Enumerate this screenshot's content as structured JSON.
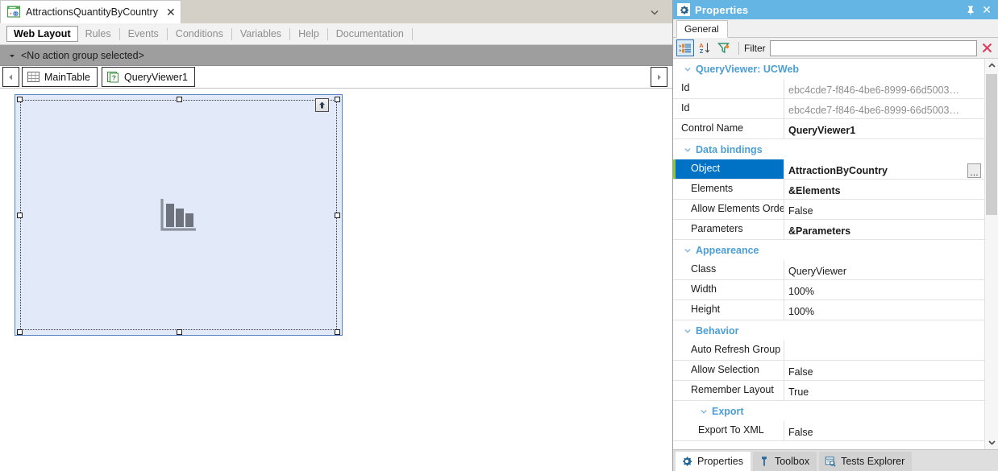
{
  "document_tab": {
    "title": "AttractionsQuantityByCountry",
    "close_label": "✕",
    "icon": "object-web-panel-icon"
  },
  "sub_tabs": [
    {
      "label": "Web Layout",
      "active": true
    },
    {
      "label": "Rules",
      "active": false
    },
    {
      "label": "Events",
      "active": false
    },
    {
      "label": "Conditions",
      "active": false
    },
    {
      "label": "Variables",
      "active": false
    },
    {
      "label": "Help",
      "active": false
    },
    {
      "label": "Documentation",
      "active": false
    }
  ],
  "action_group": {
    "label": "<No action group selected>"
  },
  "control_tabs": [
    {
      "label": "MainTable",
      "icon": "table-grid-icon"
    },
    {
      "label": "QueryViewer1",
      "icon": "queryviewer-icon"
    }
  ],
  "canvas": {
    "control_name": "QueryViewer1",
    "chart_icon": "bar-chart-icon",
    "up_arrow_icon": "arrow-up-icon"
  },
  "properties_panel": {
    "title": "Properties",
    "title_icon": "gear-icon",
    "pin_label": "📌",
    "close_label": "✕",
    "tab": "General",
    "toolbar": {
      "categorized_icon": "categorized-view-icon",
      "alphabetical_icon": "sort-alphabetical-icon",
      "filter_icon": "funnel-icon",
      "filter_label": "Filter",
      "filter_value": "",
      "filter_placeholder": "",
      "clear_icon": "clear-x-icon"
    },
    "header_group": "QueryViewer: UCWeb",
    "rows": [
      {
        "kind": "prop",
        "name": "Id",
        "value": "ebc4cde7-f846-4be6-8999-66d5003…",
        "style": "muted"
      },
      {
        "kind": "prop",
        "name": "Id",
        "value": "ebc4cde7-f846-4be6-8999-66d5003…",
        "style": "muted"
      },
      {
        "kind": "prop",
        "name": "Control Name",
        "value": "QueryViewer1",
        "style": "bold"
      },
      {
        "kind": "group",
        "name": "Data bindings",
        "level": 1
      },
      {
        "kind": "prop",
        "name": "Object",
        "value": "AttractionByCountry",
        "style": "bold",
        "selected": true,
        "indent": true,
        "ellipsis": "…"
      },
      {
        "kind": "prop",
        "name": "Elements",
        "value": "&Elements",
        "style": "bold",
        "indent": true
      },
      {
        "kind": "prop",
        "name": "Allow Elements Order C",
        "value": "False",
        "style": "normal",
        "indent": true
      },
      {
        "kind": "prop",
        "name": "Parameters",
        "value": "&Parameters",
        "style": "bold",
        "indent": true
      },
      {
        "kind": "group",
        "name": "Appeareance",
        "level": 1
      },
      {
        "kind": "prop",
        "name": "Class",
        "value": "QueryViewer",
        "style": "normal",
        "indent": true
      },
      {
        "kind": "prop",
        "name": "Width",
        "value": "100%",
        "style": "normal",
        "indent": true
      },
      {
        "kind": "prop",
        "name": "Height",
        "value": "100%",
        "style": "normal",
        "indent": true
      },
      {
        "kind": "group",
        "name": "Behavior",
        "level": 1
      },
      {
        "kind": "prop",
        "name": "Auto Refresh Group",
        "value": "",
        "style": "normal",
        "indent": true
      },
      {
        "kind": "prop",
        "name": "Allow Selection",
        "value": "False",
        "style": "normal",
        "indent": true
      },
      {
        "kind": "prop",
        "name": "Remember Layout",
        "value": "True",
        "style": "normal",
        "indent": true
      },
      {
        "kind": "group",
        "name": "Export",
        "level": 2
      },
      {
        "kind": "prop",
        "name": "Export To XML",
        "value": "False",
        "style": "normal",
        "indent2": true
      }
    ]
  },
  "bottom_tabs": [
    {
      "label": "Properties",
      "icon": "gear-icon",
      "active": true
    },
    {
      "label": "Toolbox",
      "icon": "wrench-icon",
      "active": false
    },
    {
      "label": "Tests Explorer",
      "icon": "tests-explorer-icon",
      "active": false
    }
  ],
  "colors": {
    "accent_blue": "#64b5e4",
    "selection_blue": "#0072c6",
    "group_label_blue": "#4b9ed6",
    "canvas_control_fill": "#e2e9f8",
    "canvas_control_border": "#5b83c4",
    "chrome_gray": "#9e9e9e"
  }
}
